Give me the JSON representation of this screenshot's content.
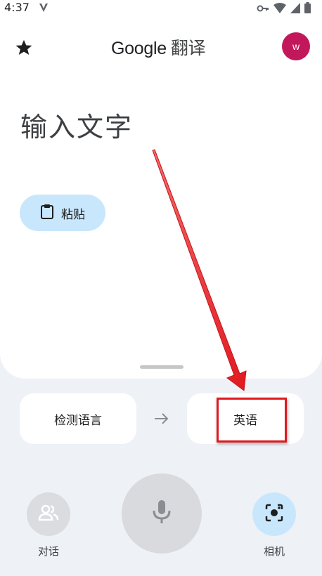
{
  "status_bar": {
    "time": "4:37",
    "icons": [
      "vpn-v-icon",
      "key-icon",
      "wifi-icon",
      "signal-icon",
      "battery-icon"
    ]
  },
  "header": {
    "title_brand": "Google",
    "title_suffix": "翻译",
    "avatar_letter": "w",
    "avatar_color": "#c2185b"
  },
  "input": {
    "placeholder": "输入文字",
    "paste_label": "粘贴"
  },
  "languages": {
    "source": "检测语言",
    "target": "英语"
  },
  "actions": {
    "conversation_label": "对话",
    "camera_label": "相机"
  },
  "colors": {
    "accent_light_blue": "#c9e7fc",
    "annotation_red": "#e0191f"
  }
}
